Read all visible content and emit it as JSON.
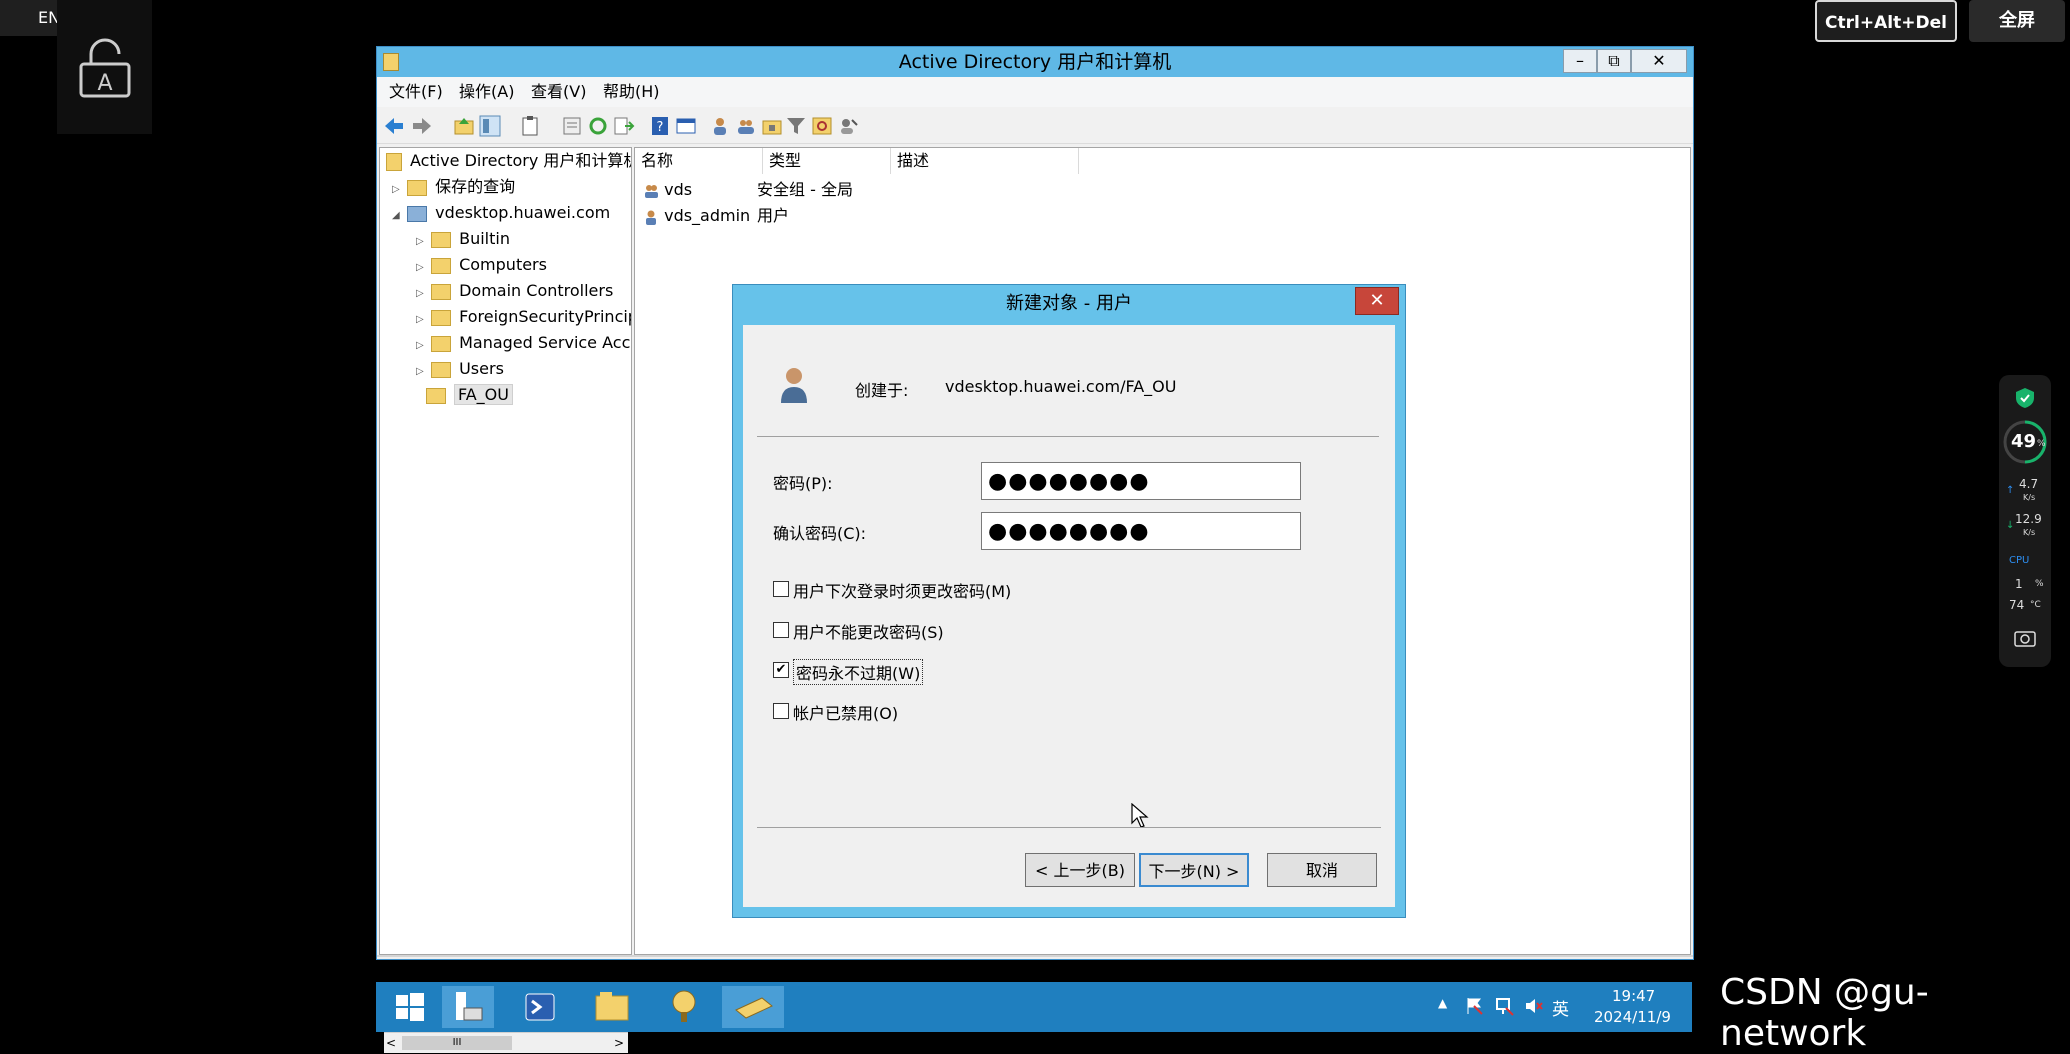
{
  "overlay": {
    "lang": "EN",
    "cad_label": "Ctrl+Alt+Del",
    "fullscreen_label": "全屏",
    "lock_letter": "A"
  },
  "window": {
    "title": "Active Directory 用户和计算机",
    "min": "–",
    "restore": "⧉",
    "close": "✕",
    "menus": [
      "文件(F)",
      "操作(A)",
      "查看(V)",
      "帮助(H)"
    ]
  },
  "tree": {
    "root": "Active Directory 用户和计算机",
    "saved_queries": "保存的查询",
    "domain": "vdesktop.huawei.com",
    "children": [
      "Builtin",
      "Computers",
      "Domain Controllers",
      "ForeignSecurityPrincipals",
      "Managed Service Accounts",
      "Users",
      "FA_OU"
    ],
    "scroll_mid": "III"
  },
  "list": {
    "columns": [
      "名称",
      "类型",
      "描述"
    ],
    "rows": [
      {
        "name": "vds",
        "type": "安全组 - 全局"
      },
      {
        "name": "vds_admin",
        "type": "用户"
      }
    ]
  },
  "dialog": {
    "title": "新建对象 - 用户",
    "close": "✕",
    "created_in_label": "创建于:",
    "created_in_value": "vdesktop.huawei.com/FA_OU",
    "password_label": "密码(P):",
    "password_value": "●●●●●●●●",
    "confirm_label": "确认密码(C):",
    "confirm_value": "●●●●●●●●",
    "options": [
      {
        "label": "用户下次登录时须更改密码(M)",
        "checked": false
      },
      {
        "label": "用户不能更改密码(S)",
        "checked": false
      },
      {
        "label": "密码永不过期(W)",
        "checked": true
      },
      {
        "label": "帐户已禁用(O)",
        "checked": false
      }
    ],
    "check_mark": "✔",
    "back_label": "< 上一步(B)",
    "next_label": "下一步(N) >",
    "cancel_label": "取消"
  },
  "taskbar": {
    "ime": "英",
    "time": "19:47",
    "date": "2024/11/9"
  },
  "widget": {
    "percent": "49",
    "percent_unit": "%",
    "up_speed": "4.7",
    "up_unit": "K/s",
    "down_speed": "12.9",
    "down_unit": "K/s",
    "cpu_label": "CPU",
    "cpu_value": "1",
    "cpu_unit": "%",
    "temp_value": "74",
    "temp_unit": "°C"
  },
  "watermark": "CSDN @gu-network"
}
